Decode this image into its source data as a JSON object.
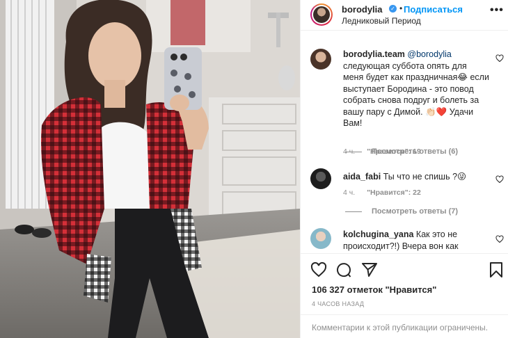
{
  "header": {
    "username": "borodylia",
    "separator": "•",
    "follow_label": "Подписаться",
    "location": "Ледниковый Период",
    "more_label": "•••"
  },
  "comments": [
    {
      "username": "borodylia.team",
      "mention": "@borodylia",
      "text": " следующая суббота опять для меня будет как праздничная😂 если выступает Бородина - это повод собрать снова подруг и болеть за вашу пару с Димой. 👏🏻❤️ Удачи Вам!",
      "time": "4 ч.",
      "likes": "\"Нравится\": 19",
      "replies": "Посмотреть ответы (6)"
    },
    {
      "username": "aida_fabi",
      "mention": "",
      "text": " Ты что не спишь ?😜",
      "time": "4 ч.",
      "likes": "\"Нравится\": 22",
      "replies": "Посмотреть ответы (7)"
    },
    {
      "username": "kolchugina_yana",
      "mention": "",
      "text": " Как это не происходит?!) Вчера вон как"
    }
  ],
  "actions": {
    "like_icon": "heart-outline-icon",
    "comment_icon": "speech-bubble-icon",
    "share_icon": "paper-plane-icon",
    "save_icon": "bookmark-icon"
  },
  "likes_summary": "106 327 отметок \"Нравится\"",
  "timestamp": "4 ЧАСОВ НАЗАД",
  "footer": {
    "comments_disabled": "Комментарии к этой публикации ограничены."
  },
  "colors": {
    "follow": "#0095f6",
    "verified": "#3897f0",
    "meta_gray": "#8e8e8e",
    "text": "#262626",
    "shirt_red": "#d42f38"
  }
}
